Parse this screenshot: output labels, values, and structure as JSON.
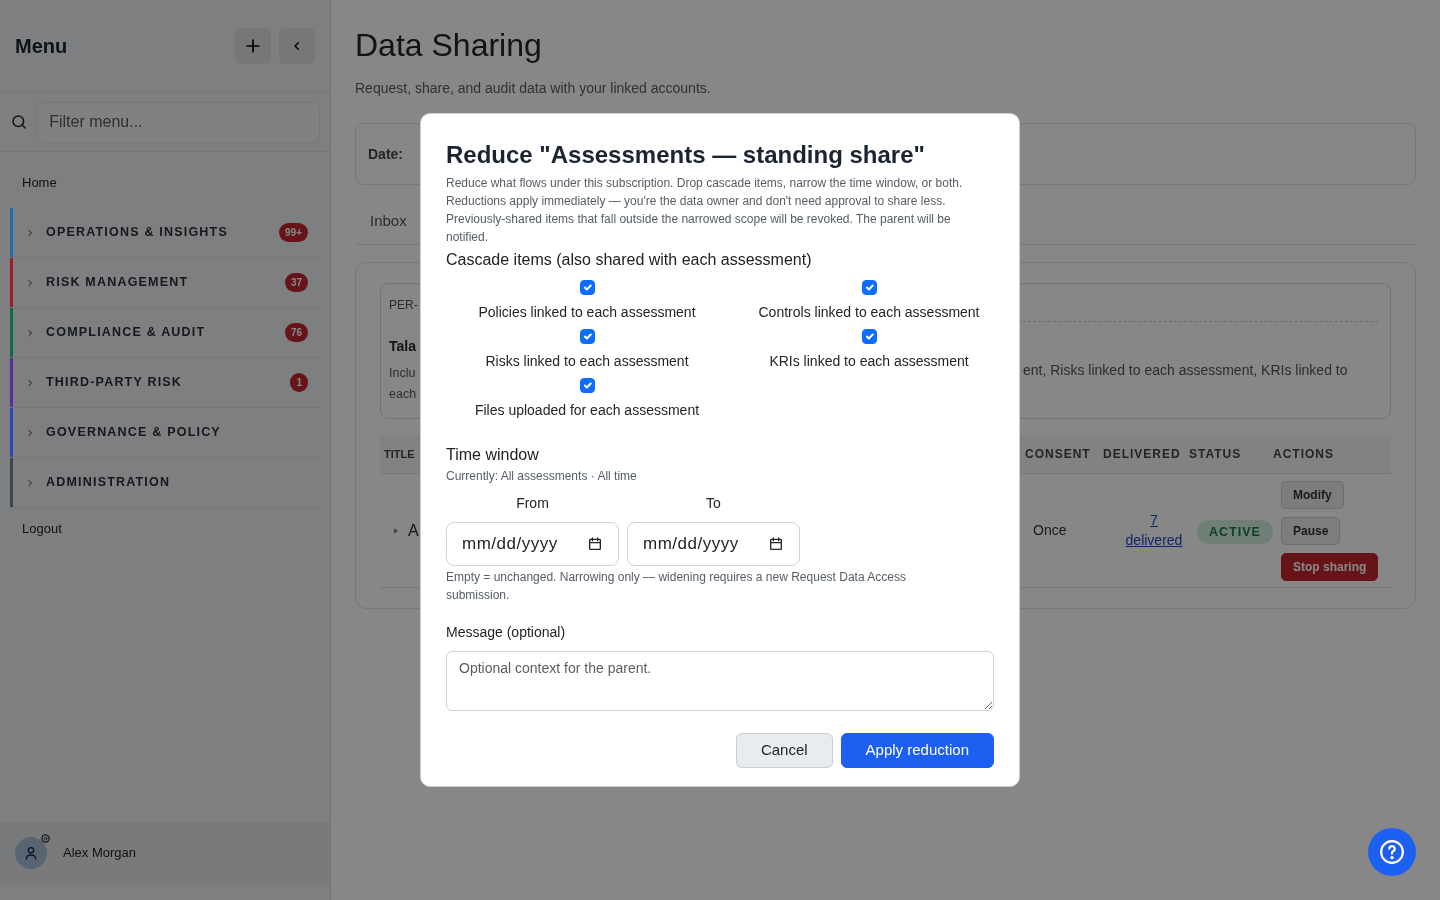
{
  "sidebar": {
    "title": "Menu",
    "filter": {
      "placeholder": "Filter menu..."
    },
    "items": [
      {
        "kind": "link",
        "label": "Home"
      },
      {
        "kind": "section",
        "label": "OPERATIONS & INSIGHTS",
        "color": "#1d6fa5",
        "badge": "99+",
        "expanded": false
      },
      {
        "kind": "section",
        "label": "RISK MANAGEMENT",
        "color": "#9b1c26",
        "badge": "37",
        "expanded": false
      },
      {
        "kind": "section",
        "label": "COMPLIANCE & AUDIT",
        "color": "#0f6b45",
        "badge": "76",
        "expanded": false
      },
      {
        "kind": "section",
        "label": "THIRD-PARTY RISK",
        "color": "#5a2ba0",
        "badge": "1",
        "expanded": false
      },
      {
        "kind": "section",
        "label": "GOVERNANCE & POLICY",
        "color": "#2848a8",
        "expanded": false
      },
      {
        "kind": "section",
        "label": "ADMINISTRATION",
        "color": "#3f4550",
        "expanded": false
      },
      {
        "kind": "link",
        "label": "Logout"
      }
    ],
    "user": {
      "name": "Alex Morgan"
    }
  },
  "page": {
    "title": "Data Sharing",
    "subtitle": "Request, share, and audit data with your linked accounts.",
    "date_label": "Date:",
    "tabs": [
      {
        "label": "Inbox",
        "selected": false
      }
    ],
    "summary": {
      "code": "PER-",
      "title": "Tala",
      "lines_left": [
        "Inclu",
        "each"
      ],
      "text_right": "ent, Risks linked to each assessment, KRIs linked to"
    },
    "table": {
      "columns_left": [
        "TITLE"
      ],
      "columns_right": [
        "CONSENT",
        "DELIVERED",
        "STATUS",
        "ACTIONS"
      ],
      "rows": [
        {
          "title": "A",
          "consent": "Once",
          "delivered_count": "7",
          "delivered_label": "delivered",
          "status": "ACTIVE",
          "actions": [
            {
              "label": "Modify",
              "kind": "secondary"
            },
            {
              "label": "Pause",
              "kind": "secondary"
            },
            {
              "label": "Stop sharing",
              "kind": "danger"
            }
          ]
        }
      ]
    }
  },
  "dialog": {
    "title": "Reduce \"Assessments — standing share\"",
    "description": "Reduce what flows under this subscription. Drop cascade items, narrow the time window, or both. Reductions apply immediately — you're the data owner and don't need approval to share less. Previously-shared items that fall outside the narrowed scope will be revoked. The parent will be notified.",
    "cascade": {
      "label": "Cascade items (also shared with each assessment)",
      "items": [
        {
          "label": "Policies linked to each assessment",
          "checked": true
        },
        {
          "label": "Controls linked to each assessment",
          "checked": true
        },
        {
          "label": "Risks linked to each assessment",
          "checked": true
        },
        {
          "label": "KRIs linked to each assessment",
          "checked": true
        },
        {
          "label": "Files uploaded for each assessment",
          "checked": true
        }
      ]
    },
    "time_window": {
      "label": "Time window",
      "current": "Currently: All assessments · All time",
      "fields": [
        {
          "label": "From",
          "placeholder": "mm/dd/yyyy"
        },
        {
          "label": "To",
          "placeholder": "mm/dd/yyyy"
        }
      ],
      "hint": "Empty = unchanged. Narrowing only — widening requires a new Request Data Access submission."
    },
    "message": {
      "label": "Message (optional)",
      "placeholder": "Optional context for the parent."
    },
    "buttons": [
      {
        "label": "Cancel",
        "kind": "secondary"
      },
      {
        "label": "Apply reduction",
        "kind": "primary"
      }
    ]
  }
}
